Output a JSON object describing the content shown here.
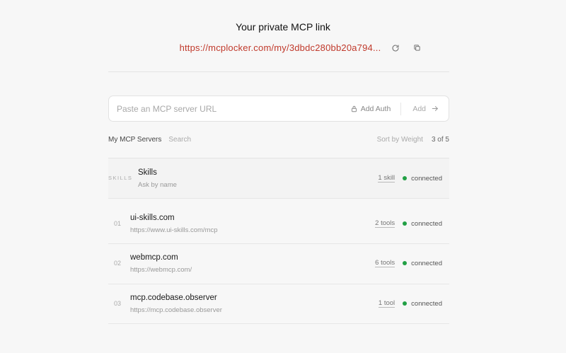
{
  "header": {
    "title": "Your private MCP link",
    "link": "https://mcplocker.com/my/3dbdc280bb20a794..."
  },
  "add_server": {
    "placeholder": "Paste an MCP server URL",
    "auth_label": "Add Auth",
    "add_label": "Add"
  },
  "list": {
    "heading": "My MCP Servers",
    "search_label": "Search",
    "sort_label": "Sort by Weight",
    "count": "3 of 5",
    "skills": {
      "prefix": "SKILLS",
      "name": "Skills",
      "subtitle": "Ask by name",
      "tools": "1 skill",
      "status": "connected"
    },
    "servers": [
      {
        "index": "01",
        "name": "ui-skills.com",
        "url": "https://www.ui-skills.com/mcp",
        "tools": "2 tools",
        "status": "connected"
      },
      {
        "index": "02",
        "name": "webmcp.com",
        "url": "https://webmcp.com/",
        "tools": "6 tools",
        "status": "connected"
      },
      {
        "index": "03",
        "name": "mcp.codebase.observer",
        "url": "https://mcp.codebase.observer",
        "tools": "1 tool",
        "status": "connected"
      }
    ]
  },
  "colors": {
    "link": "#c0392b",
    "status_connected": "#22a045"
  }
}
